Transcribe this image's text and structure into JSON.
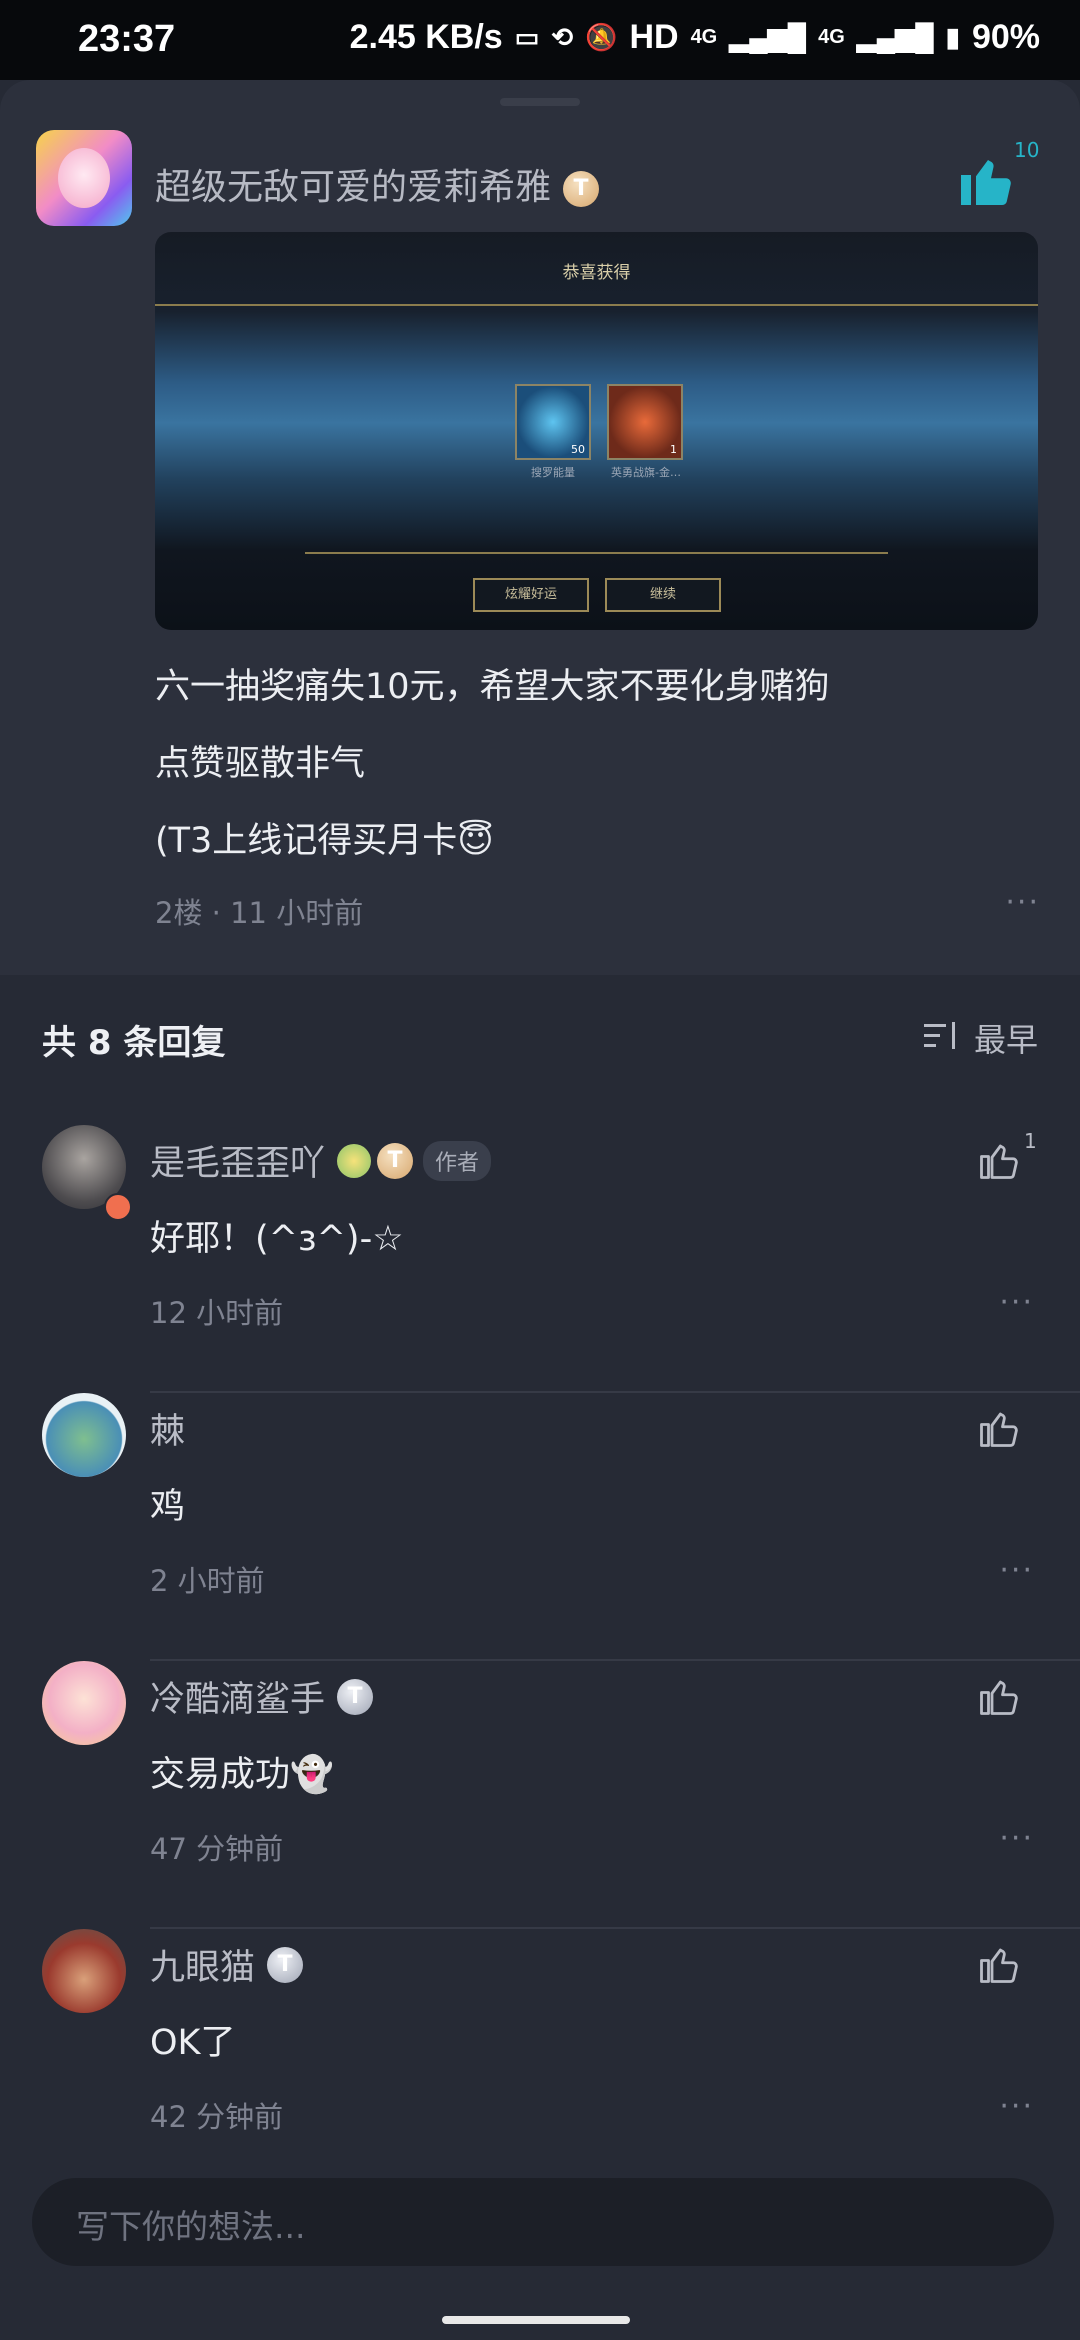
{
  "status_bar": {
    "time": "23:37",
    "speed": "2.45 KB/s",
    "hd": "HD",
    "net1": "4G",
    "net2": "4G",
    "battery": "90%"
  },
  "post": {
    "username": "超级无敌可爱的爱莉希雅",
    "level_badge": "T",
    "likes": "10",
    "image": {
      "title": "恭喜获得",
      "item1_count": "50",
      "item1_label": "搜罗能量",
      "item2_count": "1",
      "item2_label": "英勇战旗-金…",
      "button1": "炫耀好运",
      "button2": "继续"
    },
    "lines": [
      "六一抽奖痛失10元，希望大家不要化身赌狗",
      "点赞驱散非气",
      "(T3上线记得买月卡😇"
    ],
    "meta": "2楼 · 11 小时前",
    "more": "···"
  },
  "replies_header": {
    "title": "共 8 条回复",
    "sort_label": "最早"
  },
  "comments": [
    {
      "name": "是毛歪歪吖",
      "author_tag": "作者",
      "text": "好耶！(^з^)-☆",
      "time": "12 小时前",
      "likes": "1"
    },
    {
      "name": "棘",
      "text": "鸡",
      "time": "2 小时前"
    },
    {
      "name": "冷酷滴鲨手",
      "text": "交易成功👻",
      "time": "47 分钟前"
    },
    {
      "name": "九眼猫",
      "text": "OK了",
      "time": "42 分钟前"
    }
  ],
  "input": {
    "placeholder": "写下你的想法..."
  },
  "colors": {
    "accent": "#26b4c8",
    "background": "#262a35",
    "post_background": "#2c303c"
  }
}
